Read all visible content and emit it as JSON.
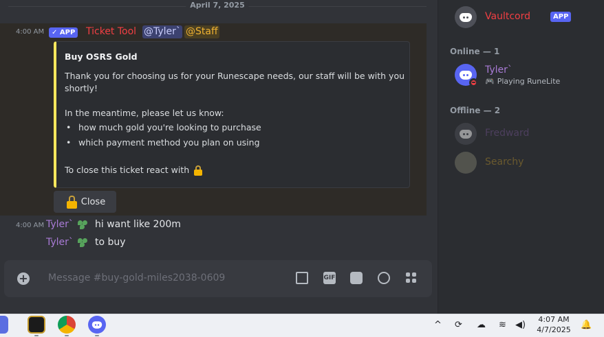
{
  "chat": {
    "date": "April 7, 2025",
    "bot_message": {
      "time": "4:00 AM",
      "app_badge": "APP",
      "author": "Ticket Tool",
      "mention_user": "@Tyler`",
      "mention_role": "@Staff",
      "embed": {
        "title": "Buy OSRS Gold",
        "line1": "Thank you for choosing us for your Runescape needs, our staff will be with you",
        "line2": "shortly!",
        "line3": "In the meantime, please let us know:",
        "bullets": [
          "how much gold you're looking to purchase",
          "which payment method you plan on using"
        ],
        "close_text": "To close this ticket react with"
      },
      "button_label": "Close"
    },
    "user_messages": [
      {
        "time": "4:00 AM",
        "author": "Tyler`",
        "text": "hi want like 200m"
      },
      {
        "author": "Tyler`",
        "text": "to buy"
      }
    ],
    "composer": {
      "placeholder": "Message #buy-gold-miles2038-0609"
    }
  },
  "members": {
    "top": {
      "name": "Vaultcord",
      "badge": "APP"
    },
    "online_header": "Online — 1",
    "online": [
      {
        "name": "Tyler`",
        "activity": "Playing RuneLite"
      }
    ],
    "offline_header": "Offline — 2",
    "offline": [
      {
        "name": "Fredward"
      },
      {
        "name": "Searchy"
      }
    ]
  },
  "taskbar": {
    "time": "4:07 AM",
    "date": "4/7/2025"
  },
  "colors": {
    "accent": "#5865f2",
    "embed_bar": "#fee75c",
    "bot_name": "#f23f43",
    "user_name": "#a97bd6"
  }
}
